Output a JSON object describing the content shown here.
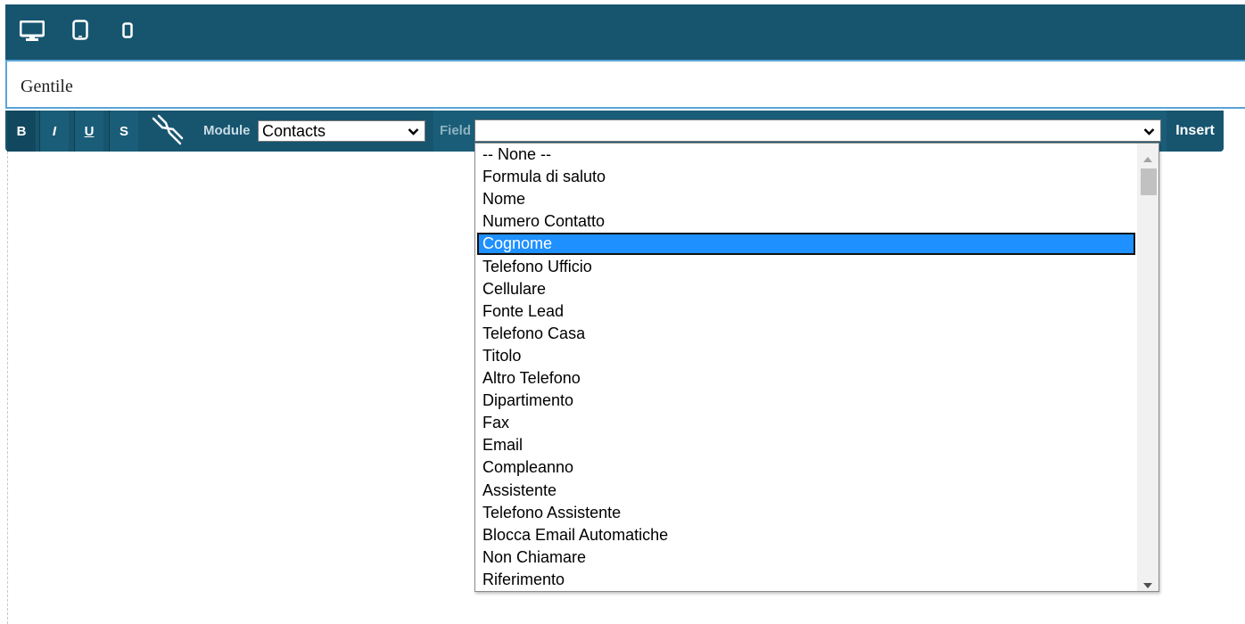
{
  "device_bar": {
    "icons": [
      "desktop-icon",
      "tablet-icon",
      "mobile-icon"
    ]
  },
  "editor": {
    "text": "Gentile"
  },
  "toolbar": {
    "bold_label": "B",
    "italic_label": "I",
    "underline_label": "U",
    "strike_label": "S",
    "unlink_icon": "unlink-icon",
    "module_label": "Module",
    "module_value": "Contacts",
    "field_label": "Field",
    "field_value": "",
    "insert_label": "Insert"
  },
  "field_dropdown": {
    "selected_index": 4,
    "options": [
      "-- None --",
      "Formula di saluto",
      "Nome",
      "Numero Contatto",
      "Cognome",
      "Telefono Ufficio",
      "Cellulare",
      "Fonte Lead",
      "Telefono Casa",
      "Titolo",
      "Altro Telefono",
      "Dipartimento",
      "Fax",
      "Email",
      "Compleanno",
      "Assistente",
      "Telefono Assistente",
      "Blocca Email Automatiche",
      "Non Chiamare",
      "Riferimento"
    ]
  },
  "colors": {
    "toolbar_bg": "#17556f",
    "highlight": "#1e90ff",
    "editor_border": "#5aa4d8"
  }
}
